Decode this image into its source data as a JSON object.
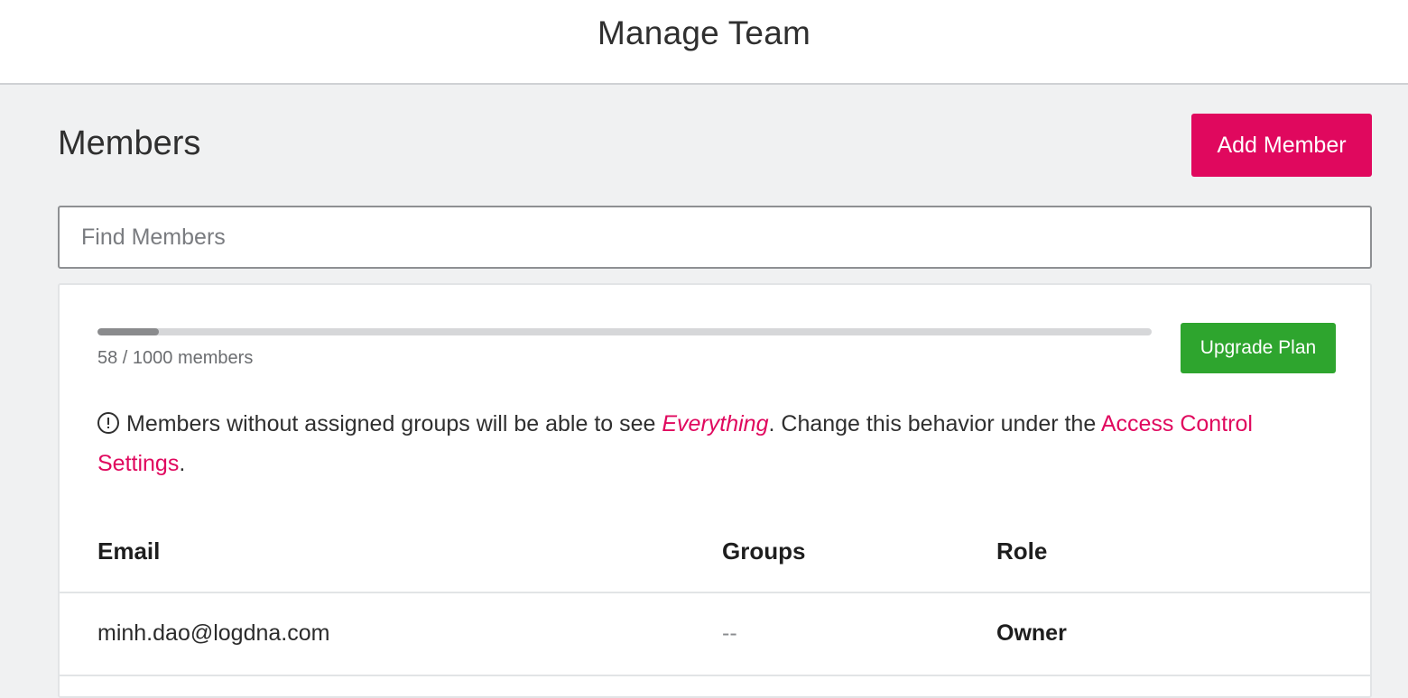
{
  "header": {
    "title": "Manage Team"
  },
  "members": {
    "title": "Members",
    "add_button": "Add Member",
    "search_placeholder": "Find Members"
  },
  "plan": {
    "used": 58,
    "limit": 1000,
    "usage_fraction": 0.058,
    "usage_label": "58 / 1000 members",
    "upgrade_button": "Upgrade Plan"
  },
  "notice": {
    "icon": "info-circle-icon",
    "text_before": "Members without assigned groups will be able to see ",
    "highlight": "Everything",
    "text_middle": ". Change this behavior under the ",
    "link": "Access Control Settings",
    "text_after": "."
  },
  "table": {
    "columns": [
      "Email",
      "Groups",
      "Role"
    ],
    "rows": [
      {
        "email": "minh.dao@logdna.com",
        "groups": "--",
        "role": "Owner"
      }
    ]
  },
  "colors": {
    "accent": "#e0085e",
    "upgrade": "#2ea52e",
    "background": "#f0f1f2"
  }
}
